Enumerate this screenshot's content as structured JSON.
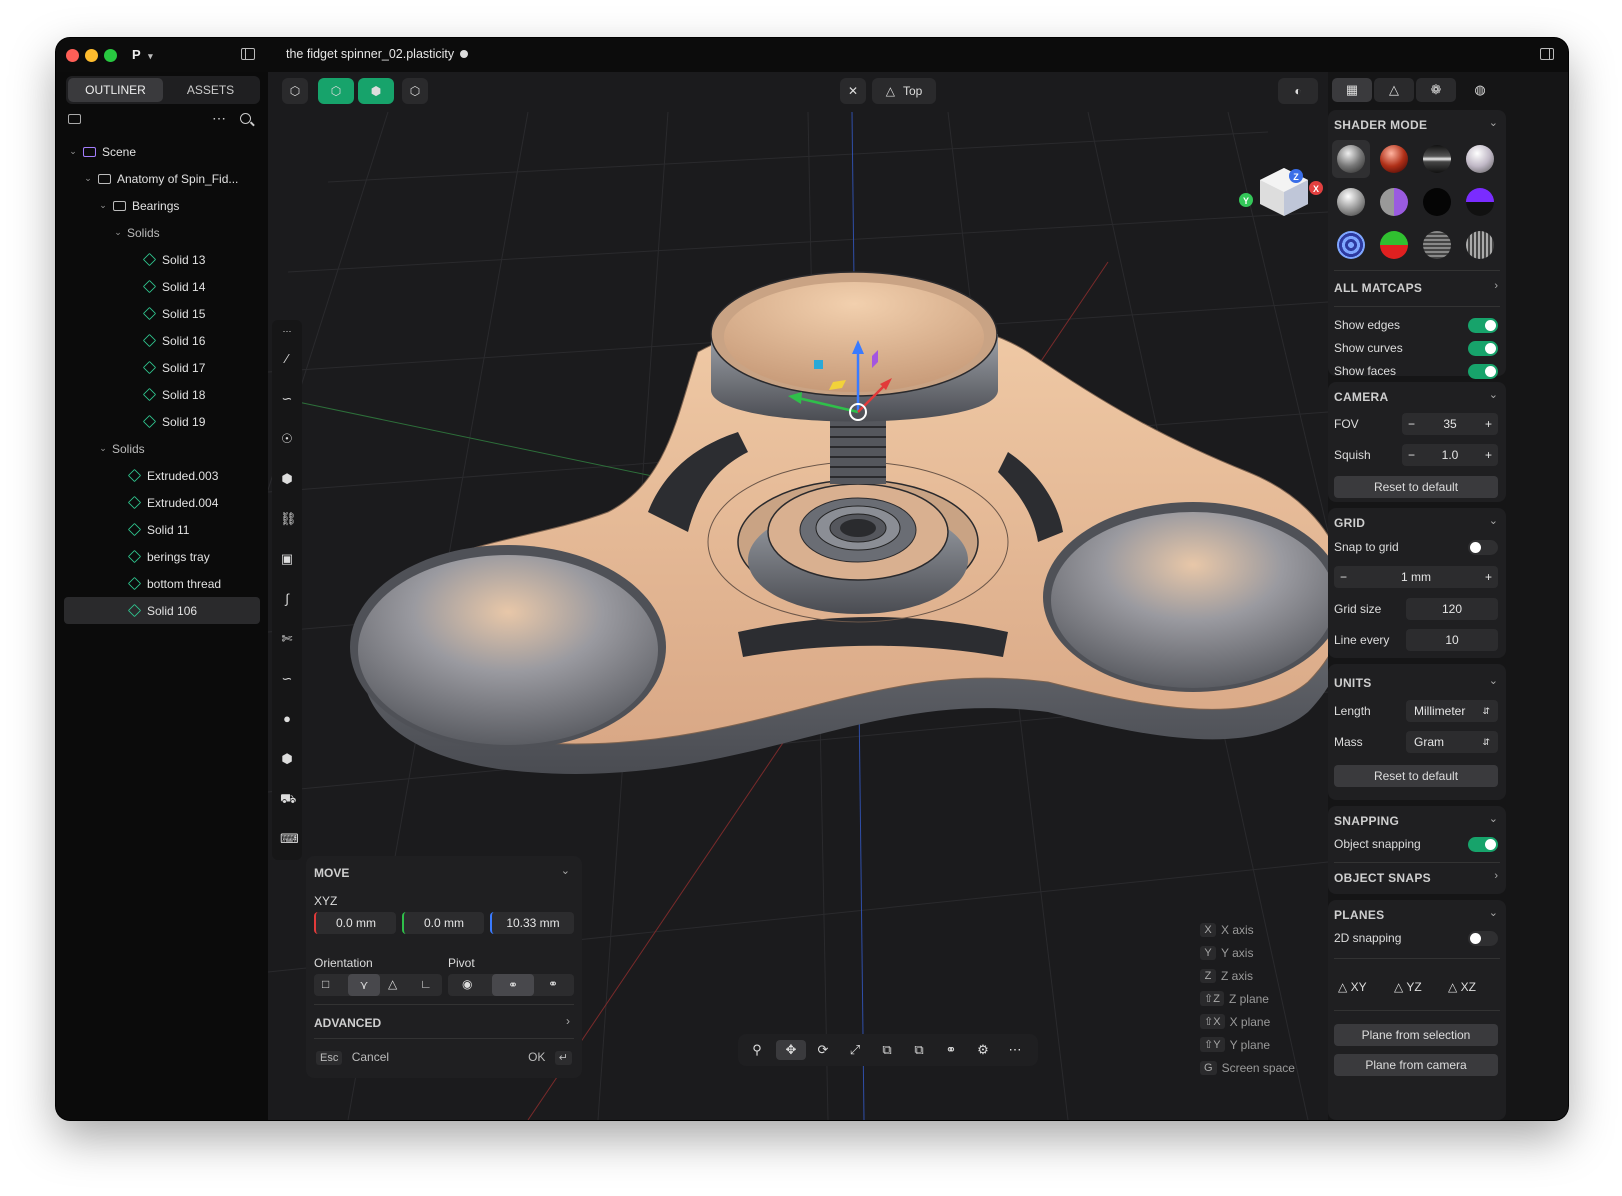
{
  "titlebar": {
    "filename": "the fidget spinner_02.plasticity",
    "app_logo": "P"
  },
  "left_tabs": [
    {
      "label": "OUTLINER",
      "active": true
    },
    {
      "label": "ASSETS",
      "active": false
    }
  ],
  "tree": [
    {
      "label": "Scene",
      "depth": 0,
      "type": "scene",
      "expanded": true
    },
    {
      "label": "Anatomy of Spin_Fid...",
      "depth": 1,
      "type": "folder",
      "expanded": true
    },
    {
      "label": "Bearings",
      "depth": 2,
      "type": "folder",
      "expanded": true
    },
    {
      "label": "Solids",
      "depth": 3,
      "type": "group",
      "expanded": true
    },
    {
      "label": "Solid 13",
      "depth": 4,
      "type": "solid"
    },
    {
      "label": "Solid 14",
      "depth": 4,
      "type": "solid"
    },
    {
      "label": "Solid 15",
      "depth": 4,
      "type": "solid"
    },
    {
      "label": "Solid 16",
      "depth": 4,
      "type": "solid"
    },
    {
      "label": "Solid 17",
      "depth": 4,
      "type": "solid"
    },
    {
      "label": "Solid 18",
      "depth": 4,
      "type": "solid"
    },
    {
      "label": "Solid 19",
      "depth": 4,
      "type": "solid"
    },
    {
      "label": "Solids",
      "depth": 2,
      "type": "group",
      "expanded": true
    },
    {
      "label": "Extruded.003",
      "depth": 3,
      "type": "solid"
    },
    {
      "label": "Extruded.004",
      "depth": 3,
      "type": "solid"
    },
    {
      "label": "Solid 11",
      "depth": 3,
      "type": "solid"
    },
    {
      "label": "berings tray",
      "depth": 3,
      "type": "solid"
    },
    {
      "label": "bottom thread",
      "depth": 3,
      "type": "solid"
    },
    {
      "label": "Solid 106",
      "depth": 3,
      "type": "solid",
      "selected": true
    }
  ],
  "viewport": {
    "view_label": "Top",
    "move": {
      "title": "MOVE",
      "xyz_label": "XYZ",
      "x": "0.0 mm",
      "y": "0.0 mm",
      "z": "10.33 mm",
      "orientation_label": "Orientation",
      "pivot_label": "Pivot",
      "advanced_label": "ADVANCED",
      "esc_key": "Esc",
      "cancel_label": "Cancel",
      "ok_label": "OK"
    },
    "shortcuts": [
      {
        "key": "X",
        "label": "X axis"
      },
      {
        "key": "Y",
        "label": "Y axis"
      },
      {
        "key": "Z",
        "label": "Z axis"
      },
      {
        "key": "⇧Z",
        "label": "Z plane"
      },
      {
        "key": "⇧X",
        "label": "X plane"
      },
      {
        "key": "⇧Y",
        "label": "Y plane"
      },
      {
        "key": "G",
        "label": "Screen space"
      }
    ],
    "gizmo_axes": {
      "x": "X",
      "y": "Y",
      "z": "Z"
    }
  },
  "right_panel": {
    "shader_mode": {
      "title": "SHADER MODE"
    },
    "all_matcaps": {
      "title": "ALL MATCAPS"
    },
    "display": [
      {
        "label": "Show edges",
        "on": true
      },
      {
        "label": "Show curves",
        "on": true
      },
      {
        "label": "Show faces",
        "on": true
      }
    ],
    "camera": {
      "title": "CAMERA",
      "fov_label": "FOV",
      "fov": "35",
      "squish_label": "Squish",
      "squish": "1.0",
      "reset": "Reset to default"
    },
    "grid": {
      "title": "GRID",
      "snap_label": "Snap to grid",
      "snap_on": false,
      "step": "1 mm",
      "size_label": "Grid size",
      "size": "120",
      "line_label": "Line every",
      "line": "10"
    },
    "units": {
      "title": "UNITS",
      "length_label": "Length",
      "length": "Millimeter",
      "mass_label": "Mass",
      "mass": "Gram",
      "reset": "Reset to default"
    },
    "snapping": {
      "title": "SNAPPING",
      "object_label": "Object snapping",
      "object_on": true
    },
    "object_snaps": {
      "title": "OBJECT SNAPS"
    },
    "planes": {
      "title": "PLANES",
      "snap2d_label": "2D snapping",
      "snap2d_on": false,
      "xy": "XY",
      "yz": "YZ",
      "xz": "XZ",
      "from_selection": "Plane from selection",
      "from_camera": "Plane from camera"
    }
  }
}
